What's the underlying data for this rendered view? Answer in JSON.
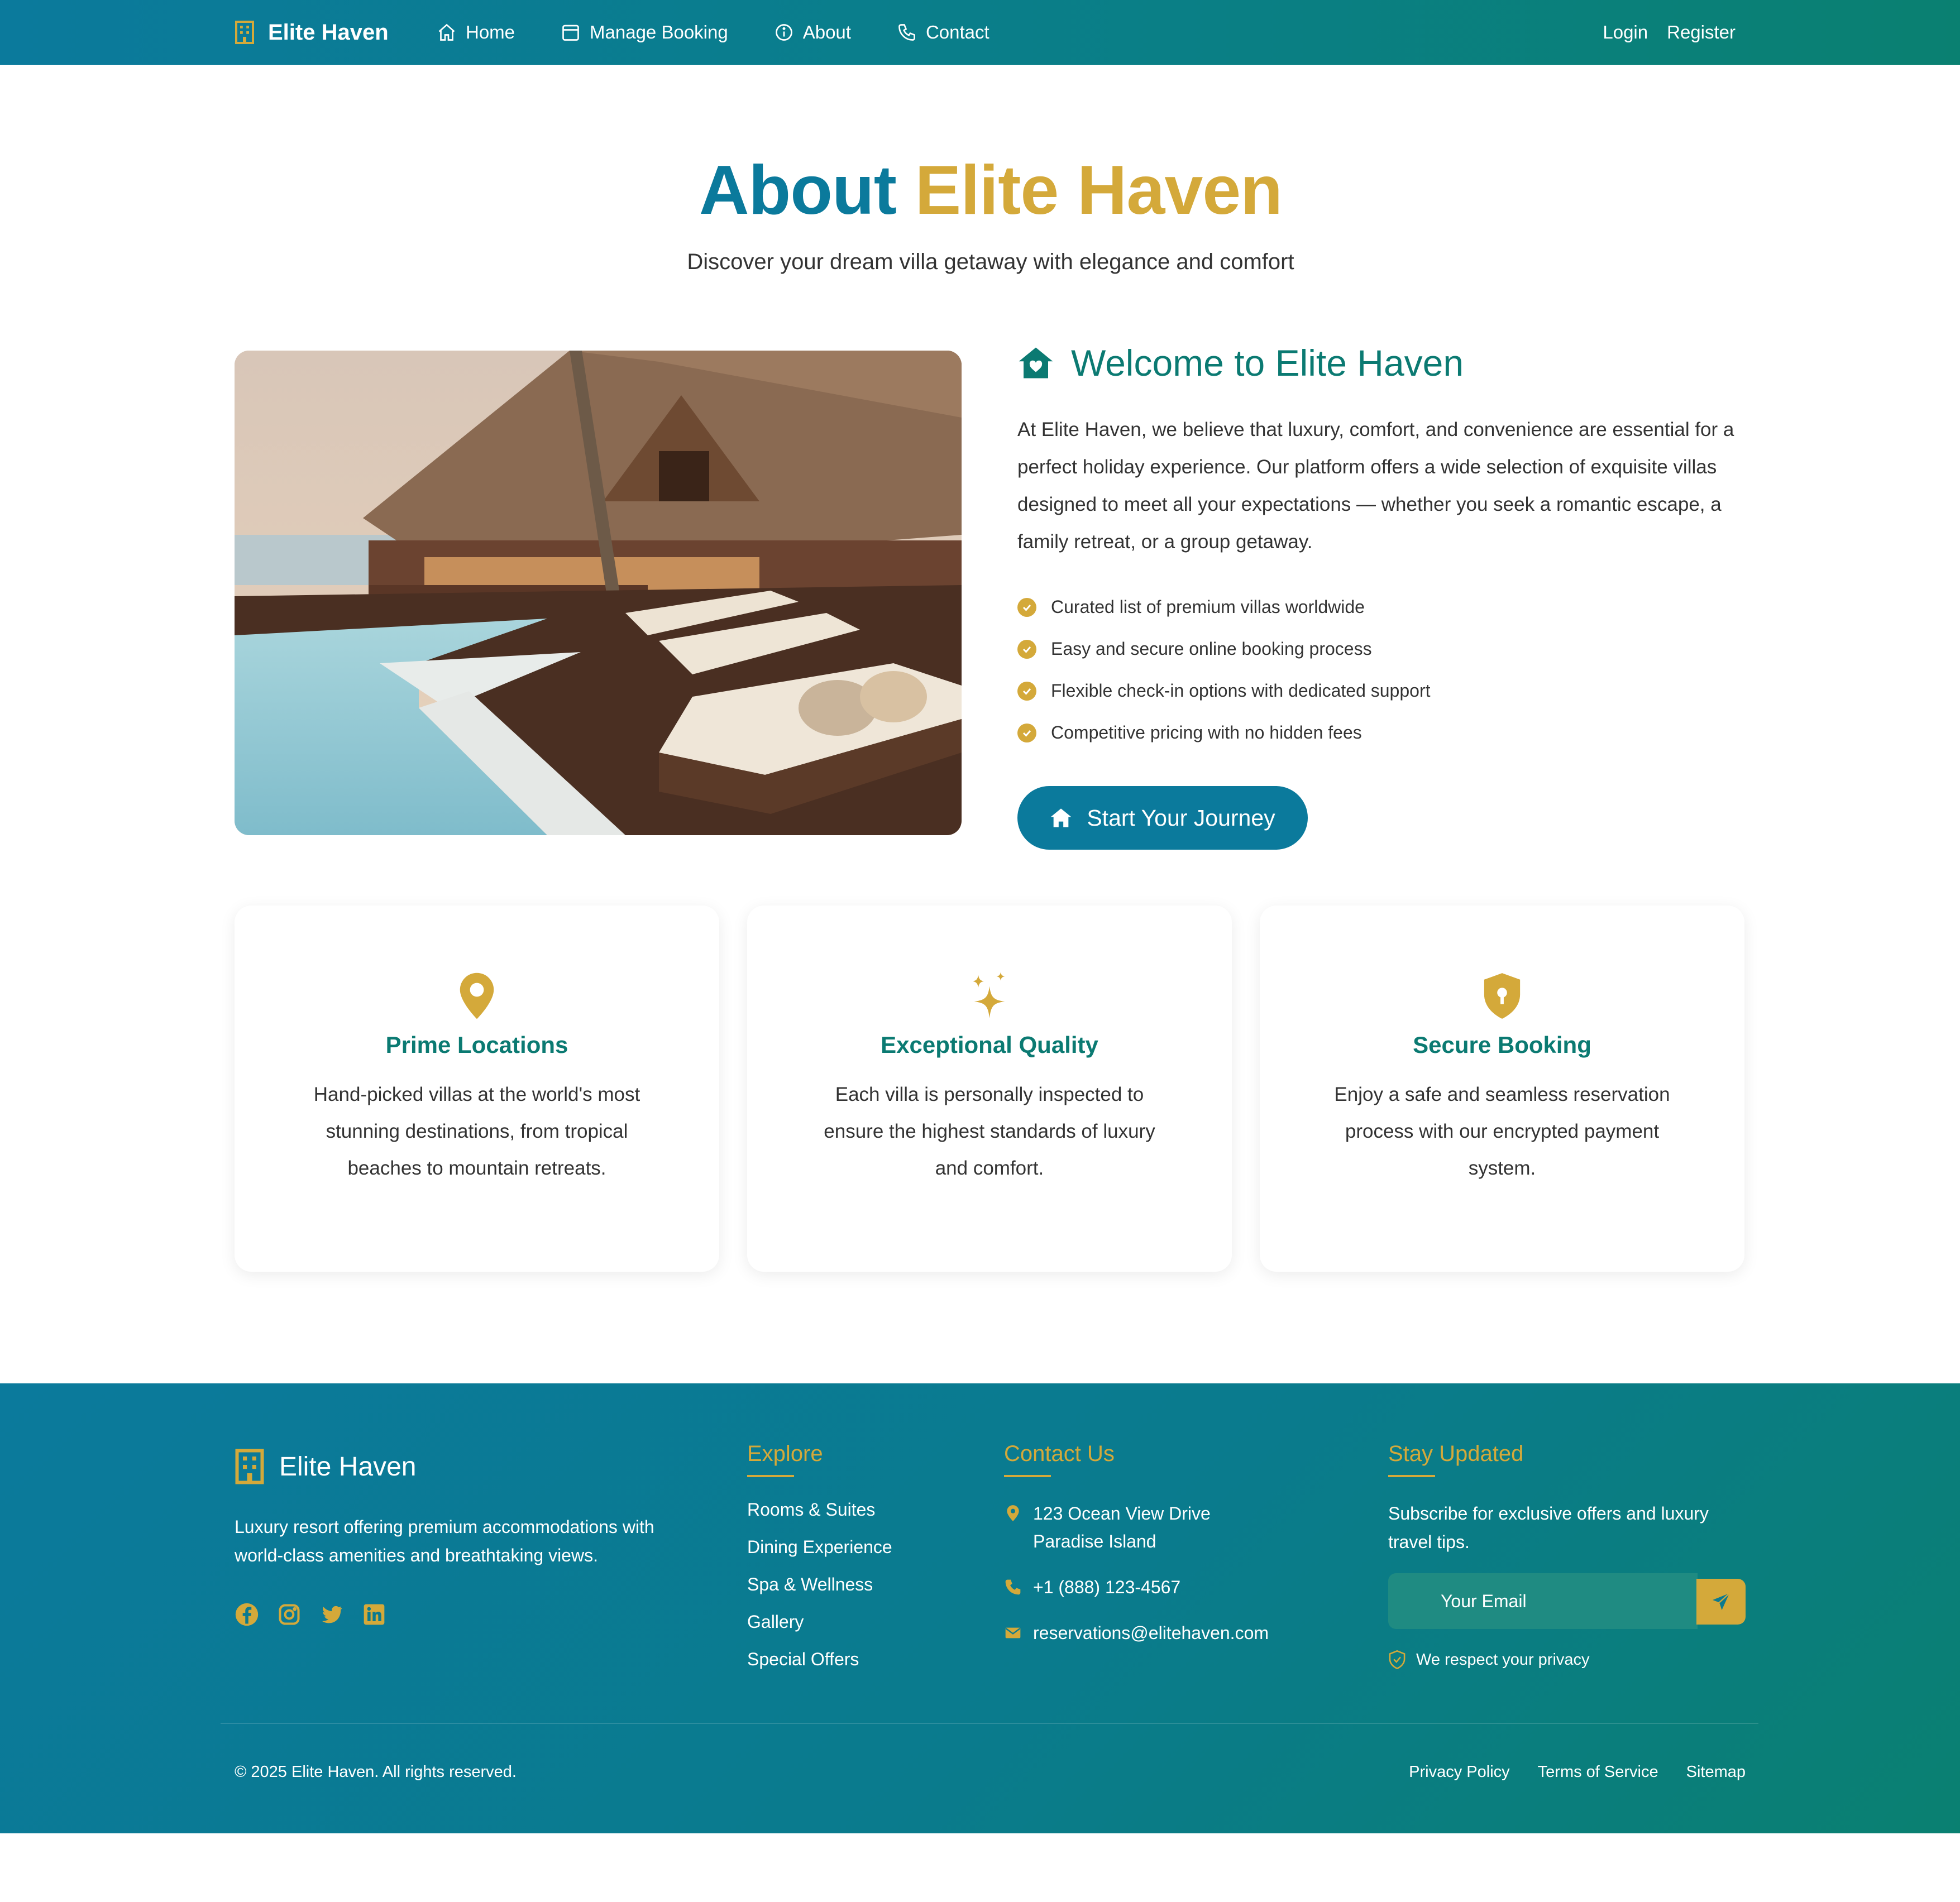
{
  "nav": {
    "brand": "Elite Haven",
    "links": [
      {
        "label": "Home",
        "icon": "home-icon"
      },
      {
        "label": "Manage Booking",
        "icon": "calendar-icon"
      },
      {
        "label": "About",
        "icon": "info-icon"
      },
      {
        "label": "Contact",
        "icon": "phone-icon"
      }
    ],
    "login": "Login",
    "register": "Register"
  },
  "hero": {
    "title_part1": "About",
    "title_part2": "Elite Haven",
    "subtitle": "Discover your dream villa getaway with elegance and comfort"
  },
  "welcome": {
    "title": "Welcome to Elite Haven",
    "text": "At Elite Haven, we believe that luxury, comfort, and convenience are essential for a perfect holiday experience. Our platform offers a wide selection of exquisite villas designed to meet all your expectations — whether you seek a romantic escape, a family retreat, or a group getaway.",
    "features": [
      "Curated list of premium villas worldwide",
      "Easy and secure online booking process",
      "Flexible check-in options with dedicated support",
      "Competitive pricing with no hidden fees"
    ],
    "cta": "Start Your Journey"
  },
  "cards": [
    {
      "icon": "map-pin-icon",
      "title": "Prime Locations",
      "text": "Hand-picked villas at the world's most stunning destinations, from tropical beaches to mountain retreats."
    },
    {
      "icon": "sparkles-icon",
      "title": "Exceptional Quality",
      "text": "Each villa is personally inspected to ensure the highest standards of luxury and comfort."
    },
    {
      "icon": "shield-lock-icon",
      "title": "Secure Booking",
      "text": "Enjoy a safe and seamless reservation process with our encrypted payment system."
    }
  ],
  "footer": {
    "brand": "Elite Haven",
    "description": "Luxury resort offering premium accommodations with world-class amenities and breathtaking views.",
    "social": [
      "facebook-icon",
      "instagram-icon",
      "twitter-icon",
      "linkedin-icon"
    ],
    "explore_title": "Explore",
    "explore_links": [
      "Rooms & Suites",
      "Dining Experience",
      "Spa & Wellness",
      "Gallery",
      "Special Offers"
    ],
    "contact_title": "Contact Us",
    "address_line1": "123 Ocean View Drive",
    "address_line2": "Paradise Island",
    "phone": "+1 (888) 123-4567",
    "email": "reservations@elitehaven.com",
    "updates_title": "Stay Updated",
    "updates_text": "Subscribe for exclusive offers and luxury travel tips.",
    "email_placeholder": "Your Email",
    "privacy": "We respect your privacy",
    "copyright": "© 2025 Elite Haven. All rights reserved.",
    "bottom_links": [
      "Privacy Policy",
      "Terms of Service",
      "Sitemap"
    ]
  },
  "colors": {
    "primary": "#0b7a9c",
    "teal": "#0b7a72",
    "gold": "#d4a93a"
  }
}
